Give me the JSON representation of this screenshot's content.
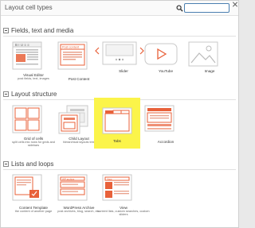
{
  "dialog": {
    "title": "Layout cell types",
    "search": {
      "placeholder": "",
      "value": ""
    }
  },
  "sections": [
    {
      "label": "Fields, text and media",
      "cards": [
        {
          "name": "Visual Editor",
          "desc": "post fields, text, images"
        },
        {
          "name": "Post Content",
          "desc": ""
        },
        {
          "name": "Slider",
          "desc": ""
        },
        {
          "name": "YouTube",
          "desc": ""
        },
        {
          "name": "Image",
          "desc": ""
        }
      ]
    },
    {
      "label": "Layout structure",
      "cards": [
        {
          "name": "Grid of cells",
          "desc": "split cells into rows for grids and sidebars"
        },
        {
          "name": "Child Layout",
          "desc": "hierarchical layouts tree"
        },
        {
          "name": "Tabs",
          "desc": ""
        },
        {
          "name": "Accordion",
          "desc": ""
        }
      ]
    },
    {
      "label": "Lists and loops",
      "cards": [
        {
          "name": "Content Template",
          "desc": "the content of another page"
        },
        {
          "name": "WordPress Archive",
          "desc": "post archives, blog, search, etc."
        },
        {
          "name": "View",
          "desc": "content lists, custom searches, custom sliders"
        }
      ]
    }
  ],
  "thumb_text": {
    "post_content_tag": "Post content",
    "wp_archive_tag": "WP archive",
    "view_tag": "View"
  },
  "colors": {
    "accent": "#e8613a",
    "selected_bg": "#fbf44a",
    "icon_gray": "#9a9a9a"
  }
}
